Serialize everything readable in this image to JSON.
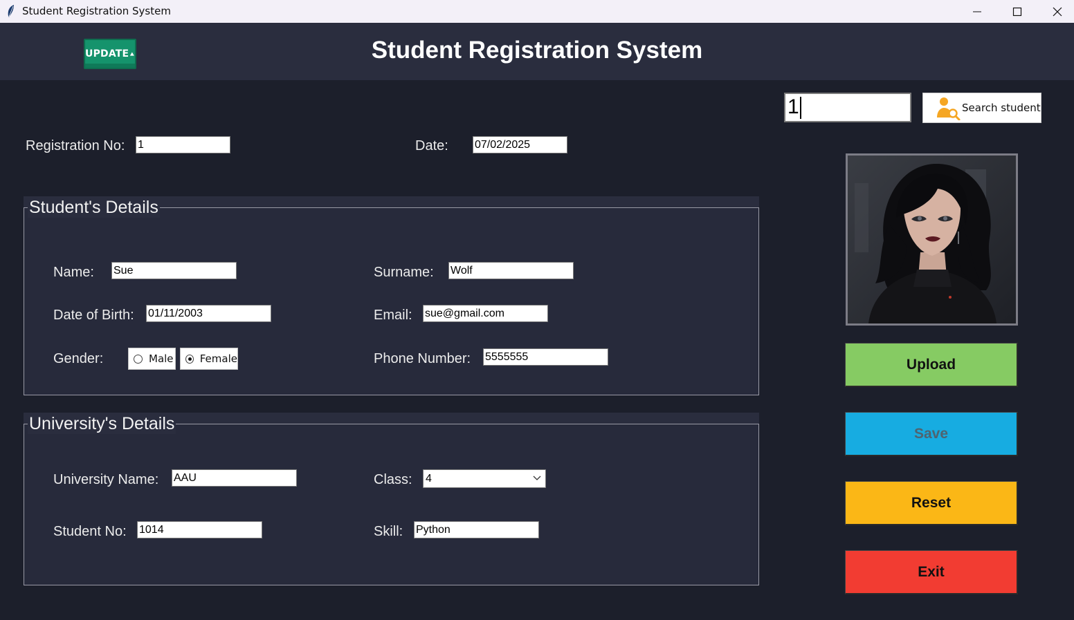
{
  "window": {
    "title": "Student Registration System"
  },
  "header": {
    "badge": "UPDATE",
    "title": "Student Registration System"
  },
  "search": {
    "value": "1",
    "button_label": "Search student"
  },
  "top_row": {
    "registration_label": "Registration No:",
    "registration_value": "1",
    "date_label": "Date:",
    "date_value": "07/02/2025"
  },
  "student_details": {
    "title": "Student's Details",
    "name_label": "Name:",
    "name_value": "Sue",
    "surname_label": "Surname:",
    "surname_value": "Wolf",
    "dob_label": "Date of Birth:",
    "dob_value": "01/11/2003",
    "email_label": "Email:",
    "email_value": "sue@gmail.com",
    "gender_label": "Gender:",
    "gender_options": [
      "Male",
      "Female"
    ],
    "gender_selected": "Female",
    "phone_label": "Phone Number:",
    "phone_value": "5555555"
  },
  "university_details": {
    "title": "University's Details",
    "university_label": "University Name:",
    "university_value": "AAU",
    "class_label": "Class:",
    "class_value": "4",
    "student_no_label": "Student No:",
    "student_no_value": "1014",
    "skill_label": "Skill:",
    "skill_value": "Python"
  },
  "actions": {
    "upload": "Upload",
    "save": "Save",
    "reset": "Reset",
    "exit": "Exit"
  },
  "colors": {
    "background": "#1c1f2b",
    "header": "#2a2d3e",
    "upload": "#86cb63",
    "save": "#17ace1",
    "reset": "#fbb716",
    "exit": "#f23c32",
    "update_badge": "#15936c"
  }
}
